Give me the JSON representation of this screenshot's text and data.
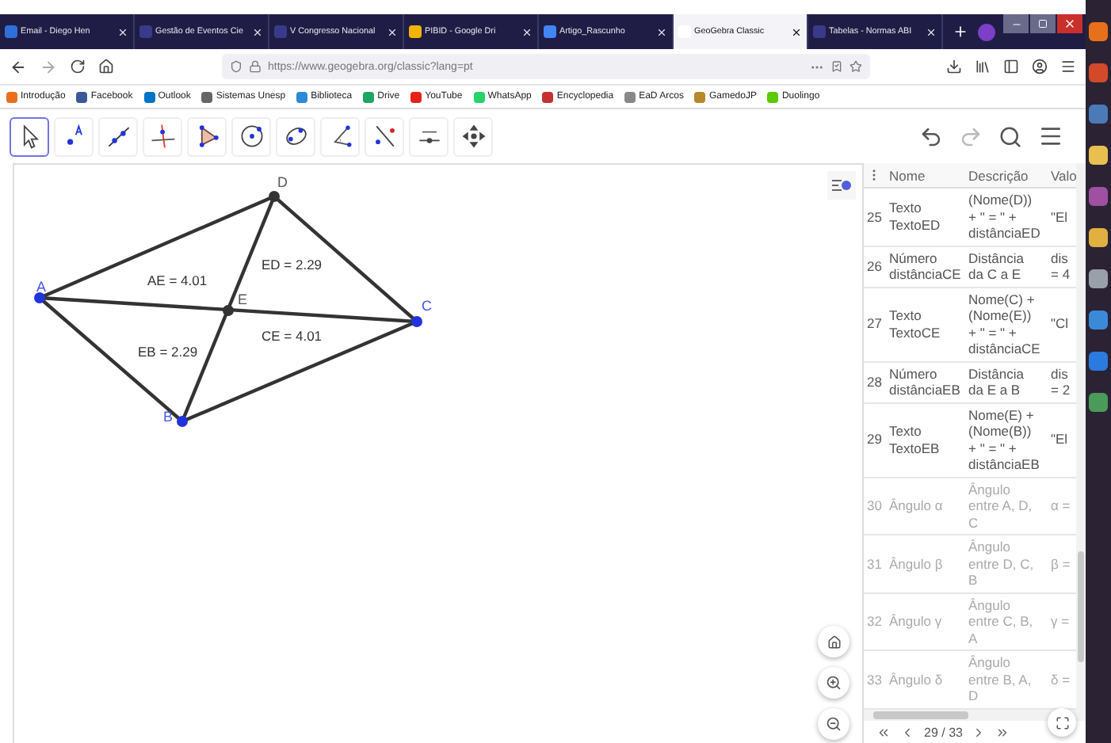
{
  "browser_tabs": [
    {
      "title": "Email - Diego Hen",
      "selected": false
    },
    {
      "title": "Gestão de Eventos Cie",
      "selected": false
    },
    {
      "title": "V Congresso Nacional",
      "selected": false
    },
    {
      "title": "PIBID - Google Dri",
      "selected": false
    },
    {
      "title": "Artigo_Rascunho",
      "selected": false
    },
    {
      "title": "GeoGebra Classic",
      "selected": true
    },
    {
      "title": "Tabelas - Normas ABI",
      "selected": false
    }
  ],
  "address_bar": {
    "url": "https://www.geogebra.org/classic?lang=pt"
  },
  "bookmarks": [
    "Introdução",
    "Facebook",
    "Outlook",
    "Sistemas Unesp",
    "Biblioteca",
    "Drive",
    "YouTube",
    "WhatsApp",
    "Encyclopedia",
    "EaD Arcos",
    "GamedoJP",
    "Duolingo"
  ],
  "toolbar": {
    "tools": [
      {
        "kind": "move",
        "selected": true
      },
      {
        "kind": "point",
        "selected": false
      },
      {
        "kind": "line",
        "selected": false
      },
      {
        "kind": "perpendicular",
        "selected": false
      },
      {
        "kind": "polygon",
        "selected": false
      },
      {
        "kind": "circle",
        "selected": false
      },
      {
        "kind": "conic",
        "selected": false
      },
      {
        "kind": "angle",
        "selected": false
      },
      {
        "kind": "reflect",
        "selected": false
      },
      {
        "kind": "slider",
        "selected": false
      },
      {
        "kind": "move_view",
        "selected": false
      }
    ]
  },
  "graphics": {
    "points": [
      {
        "name": "A",
        "color": "#2233dd"
      },
      {
        "name": "D",
        "color": "#333333"
      },
      {
        "name": "C",
        "color": "#2233dd"
      },
      {
        "name": "B",
        "color": "#2233dd"
      },
      {
        "name": "E",
        "color": "#333333"
      }
    ],
    "segment_labels": [
      "AE = 4.01",
      "ED = 2.29",
      "EB = 2.29",
      "CE = 4.01"
    ]
  },
  "table": {
    "columns": [
      "Nome",
      "Descrição",
      "Valo"
    ],
    "rows": [
      {
        "number": "25",
        "name": [
          "Texto",
          "TextoED"
        ],
        "description": [
          "(Nome(D))",
          "+ \" = \" +",
          "distânciaED"
        ],
        "value": [
          "\"El"
        ],
        "dimmed": false
      },
      {
        "number": "26",
        "name": [
          "Número",
          "distânciaCE"
        ],
        "description": [
          "Distância",
          "da C a E"
        ],
        "value": [
          "dis",
          "= 4"
        ],
        "dimmed": false
      },
      {
        "number": "27",
        "name": [
          "Texto",
          "TextoCE"
        ],
        "description": [
          "Nome(C) +",
          "(Nome(E))",
          "+ \" = \" +",
          "distânciaCE"
        ],
        "value": [
          "\"Cl"
        ],
        "dimmed": false
      },
      {
        "number": "28",
        "name": [
          "Número",
          "distânciaEB"
        ],
        "description": [
          "Distância",
          "da E a B"
        ],
        "value": [
          "dis",
          "= 2"
        ],
        "dimmed": false
      },
      {
        "number": "29",
        "name": [
          "Texto",
          "TextoEB"
        ],
        "description": [
          "Nome(E) +",
          "(Nome(B))",
          "+ \" = \" +",
          "distânciaEB"
        ],
        "value": [
          "\"El"
        ],
        "dimmed": false
      },
      {
        "number": "30",
        "name": [
          "Ângulo α"
        ],
        "description": [
          "Ângulo",
          "entre A, D,",
          "C"
        ],
        "value": [
          "α ="
        ],
        "dimmed": true
      },
      {
        "number": "31",
        "name": [
          "Ângulo β"
        ],
        "description": [
          "Ângulo",
          "entre D, C,",
          "B"
        ],
        "value": [
          "β ="
        ],
        "dimmed": true
      },
      {
        "number": "32",
        "name": [
          "Ângulo γ"
        ],
        "description": [
          "Ângulo",
          "entre C, B,",
          "A"
        ],
        "value": [
          "γ ="
        ],
        "dimmed": true
      },
      {
        "number": "33",
        "name": [
          "Ângulo δ"
        ],
        "description": [
          "Ângulo",
          "entre B, A,",
          "D"
        ],
        "value": [
          "δ ="
        ],
        "dimmed": true
      }
    ]
  },
  "pagination": "29 / 33"
}
